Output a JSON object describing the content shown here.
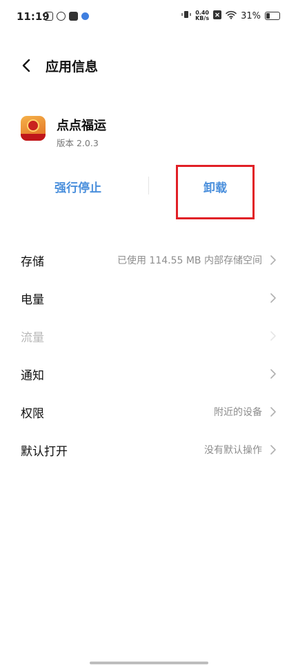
{
  "status_bar": {
    "time": "11:19",
    "net_speed_value": "0.40",
    "net_speed_unit": "KB/s",
    "battery_percent_label": "31%",
    "battery_level": 0.31
  },
  "header": {
    "title": "应用信息"
  },
  "app": {
    "name": "点点福运",
    "version": "版本 2.0.3"
  },
  "actions": {
    "force_stop": "强行停止",
    "uninstall": "卸载"
  },
  "rows": [
    {
      "label": "存储",
      "value": "已使用 114.55 MB 内部存储空间"
    },
    {
      "label": "电量",
      "value": ""
    },
    {
      "label": "流量",
      "value": ""
    },
    {
      "label": "通知",
      "value": ""
    },
    {
      "label": "权限",
      "value": "附近的设备"
    },
    {
      "label": "默认打开",
      "value": "没有默认操作"
    }
  ],
  "colors": {
    "accent": "#4a8fdc",
    "highlight_box": "#e11f26"
  }
}
